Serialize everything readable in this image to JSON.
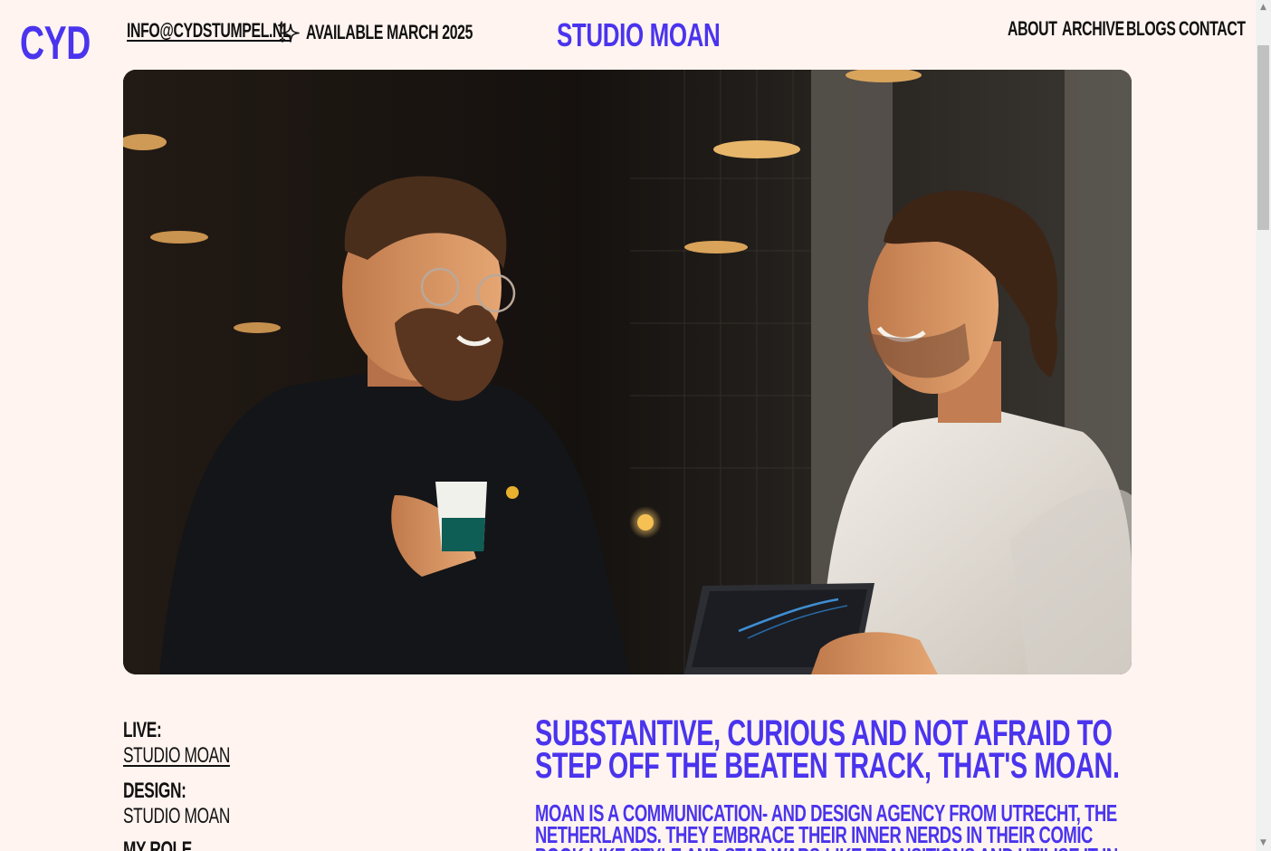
{
  "header": {
    "logo": "CYD",
    "email": "INFO@CYDSTUMPEL.NL",
    "availability": "AVAILABLE MARCH 2025",
    "title": "STUDIO MOAN",
    "nav": [
      "ABOUT",
      "ARCHIVE",
      "BLOGS",
      "CONTACT"
    ]
  },
  "hero": {
    "icon": "photo-two-men-talking"
  },
  "meta": {
    "live_label": "LIVE:",
    "live_value": "STUDIO MOAN",
    "design_label": "DESIGN:",
    "design_value": "STUDIO MOAN",
    "role_label": "MY ROLE"
  },
  "intro": {
    "headline": "SUBSTANTIVE, CURIOUS AND NOT AFRAID TO STEP OFF THE BEATEN TRACK, THAT'S MOAN.",
    "body": "MOAN IS A COMMUNICATION- AND DESIGN AGENCY FROM UTRECHT, THE NETHERLANDS. THEY EMBRACE THEIR INNER NERDS IN THEIR COMIC BOOK-LIKE STYLE AND STAR WARS-LIKE TRANSITIONS AND UTILISE IT IN THEIR EVERY DAY WORK TO"
  },
  "colors": {
    "accent": "#4a34ee",
    "background": "#fff4f0",
    "text": "#111111"
  }
}
